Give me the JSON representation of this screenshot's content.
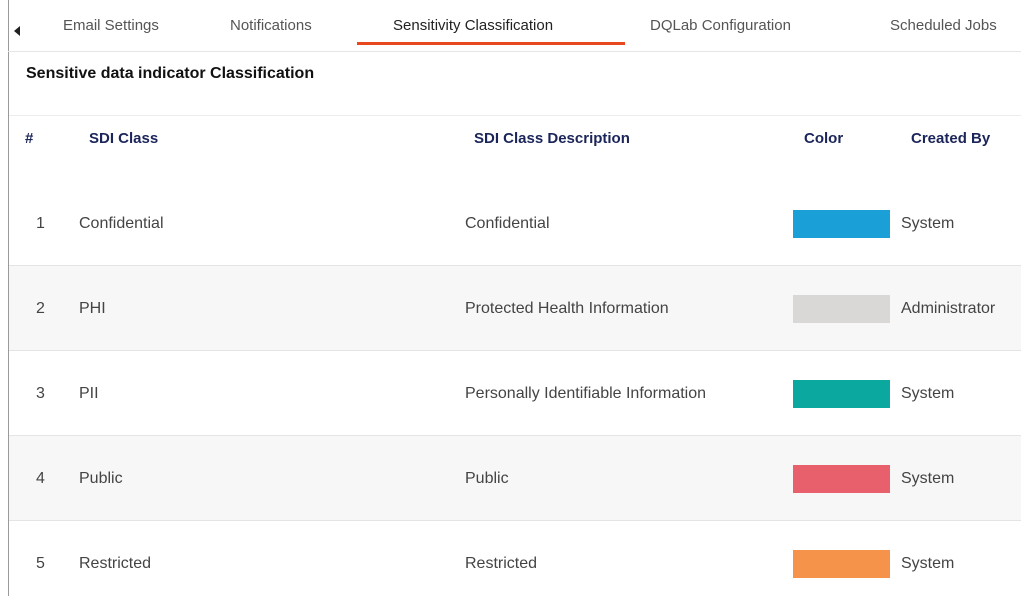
{
  "tabs": [
    {
      "label": "Email Settings",
      "active": false
    },
    {
      "label": "Notifications",
      "active": false
    },
    {
      "label": "Sensitivity Classification",
      "active": true
    },
    {
      "label": "DQLab Configuration",
      "active": false
    },
    {
      "label": "Scheduled Jobs",
      "active": false
    }
  ],
  "section_title": "Sensitive data indicator Classification",
  "table": {
    "headers": {
      "index": "#",
      "sdi_class": "SDI Class",
      "description": "SDI Class Description",
      "color": "Color",
      "created_by": "Created By"
    },
    "rows": [
      {
        "index": "1",
        "sdi_class": "Confidential",
        "description": "Confidential",
        "color": "#1a9fd6",
        "created_by": "System"
      },
      {
        "index": "2",
        "sdi_class": "PHI",
        "description": "Protected Health Information",
        "color": "#d9d8d6",
        "created_by": "Administrator"
      },
      {
        "index": "3",
        "sdi_class": "PII",
        "description": "Personally Identifiable Information",
        "color": "#0aa89e",
        "created_by": "System"
      },
      {
        "index": "4",
        "sdi_class": "Public",
        "description": "Public",
        "color": "#e8606b",
        "created_by": "System"
      },
      {
        "index": "5",
        "sdi_class": "Restricted",
        "description": "Restricted",
        "color": "#f5934a",
        "created_by": "System"
      }
    ]
  },
  "colors": {
    "active_tab_underline": "#e8481e",
    "header_text": "#1b2559"
  }
}
